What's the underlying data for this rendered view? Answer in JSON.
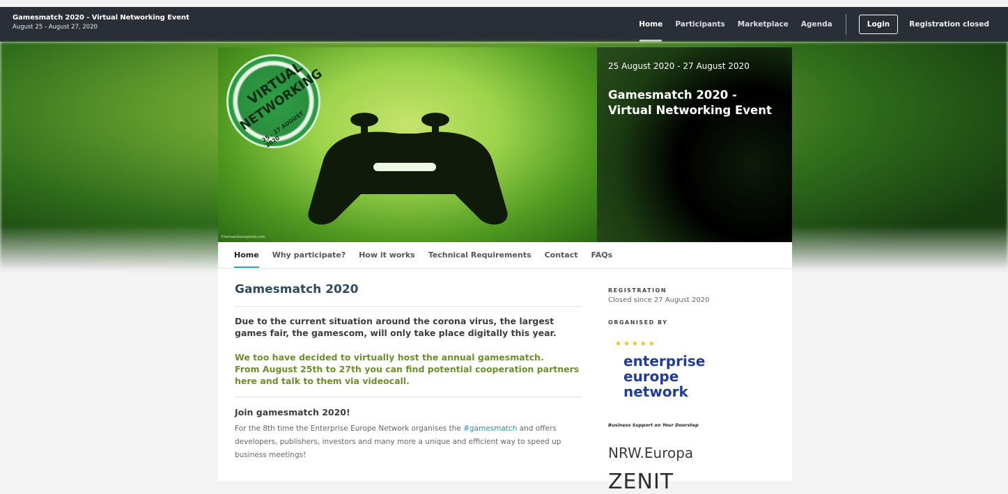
{
  "header": {
    "title": "Gamesmatch 2020 - Virtual Networking Event",
    "dates": "August 25 - August 27, 2020",
    "nav": [
      "Home",
      "Participants",
      "Marketplace",
      "Agenda"
    ],
    "login": "Login",
    "registration": "Registration closed"
  },
  "banner": {
    "stamp_line1": "VIRTUAL",
    "stamp_line2": "NETWORKING",
    "stamp_line3": "25 - 27 AUGUST 2020",
    "credit": "©farrow/istockphoto.com"
  },
  "hero": {
    "date": "25 August 2020 - 27 August 2020",
    "title": "Gamesmatch 2020 - Virtual Networking Event"
  },
  "subnav": [
    "Home",
    "Why participate?",
    "How it works",
    "Technical Requirements",
    "Contact",
    "FAQs"
  ],
  "content": {
    "heading": "Gamesmatch 2020",
    "intro": "Due to the current situation around the corona virus, the largest games fair, the gamescom, will only take place digitally this year.",
    "green_1": "We too have decided to virtually host the annual gamesmatch.",
    "green_2": "From August 25th to 27th you can find potential cooperation partners here and talk to them via videocall.",
    "sub_heading": "Join gamesmatch 2020!",
    "body_1": "For the 8th time the Enterprise Europe Network organises the",
    "body_link": "#gamesmatch",
    "body_2": "and offers developers, publishers, investors and many more a unique and efficient way to speed up business meetings!"
  },
  "sidebar": {
    "registration_label": "REGISTRATION",
    "registration_value": "Closed since 27 August 2020",
    "organised_label": "ORGANISED BY",
    "een_line1": "enterprise",
    "een_line2": "europe",
    "een_line3": "network",
    "een_slogan": "Business Support on Your Doorstep",
    "nrw": "NRW.Europa",
    "zenit": "ZENIT"
  }
}
